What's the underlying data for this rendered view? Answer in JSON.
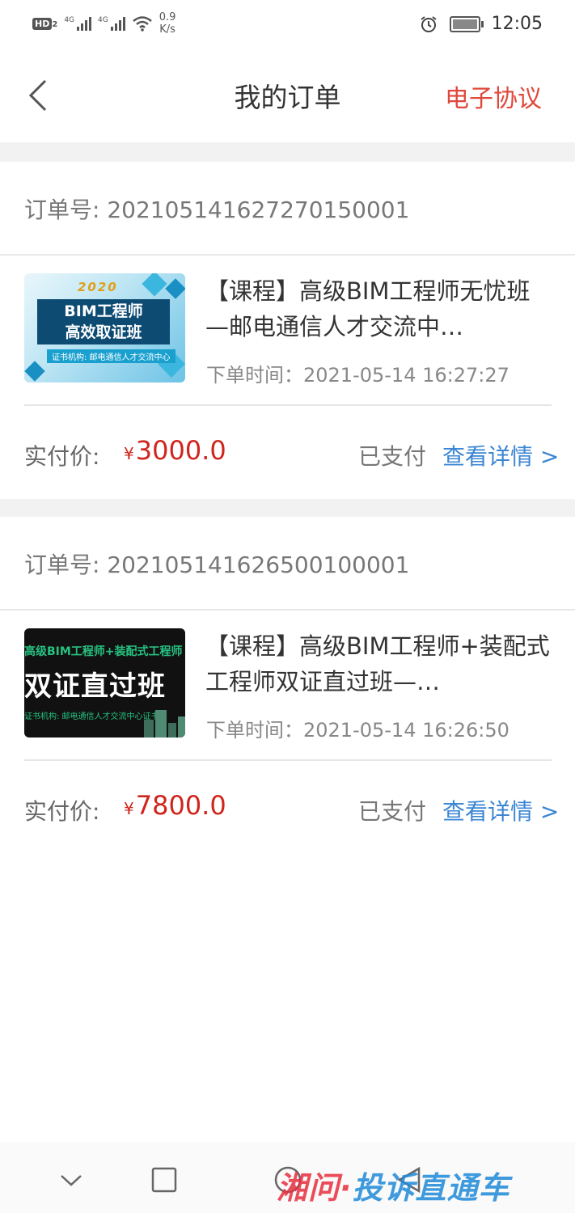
{
  "status_bar": {
    "hd_label": "HD",
    "sim_slot": "2",
    "signal_tag_1": "4G",
    "signal_tag_2": "4G",
    "speed_value": "0.9",
    "speed_unit": "K/s",
    "time": "12:05"
  },
  "header": {
    "title": "我的订单",
    "right_link": "电子协议"
  },
  "orders": [
    {
      "order_no": "订单号: 2021051416272701500​01",
      "product_title": "【课程】高级BIM工程师无忧班—邮电通信人才交流中…",
      "order_time": "下单时间：2021-05-14 16:27:27",
      "price_label": "实付价:",
      "currency": "¥",
      "price": "3000.0",
      "status": "已支付",
      "detail_link": "查看详情 >",
      "thumbnail": {
        "year": "2020",
        "line1": "BIM工程师",
        "line2": "高效取证班",
        "sub": "证书机构: 邮电通信人才交流中心"
      }
    },
    {
      "order_no": "订单号: 202105141626500100001",
      "product_title": "【课程】高级BIM工程师+装配式工程师双证直过班—…",
      "order_time": "下单时间：2021-05-14 16:26:50",
      "price_label": "实付价:",
      "currency": "¥",
      "price": "7800.0",
      "status": "已支付",
      "detail_link": "查看详情 >",
      "thumbnail": {
        "line1": "高级BIM工程师+装配式工程师",
        "line2": "双证直过班",
        "sub": "证书机构: 邮电通信人才交流中心证书"
      }
    }
  ],
  "watermark": {
    "part1": "湘问",
    "sep": "·",
    "part2": "投诉直通车"
  },
  "colors": {
    "accent_red": "#e0483c",
    "price_red": "#d0251d",
    "link_blue": "#3a86d4",
    "gap_gray": "#f2f2f2"
  }
}
